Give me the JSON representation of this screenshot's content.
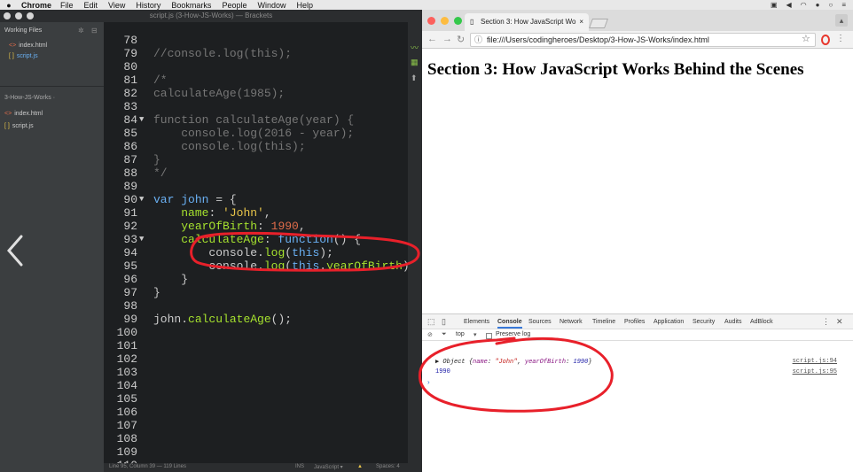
{
  "menubar": {
    "app": "Chrome",
    "items": [
      "File",
      "Edit",
      "View",
      "History",
      "Bookmarks",
      "People",
      "Window",
      "Help"
    ]
  },
  "brackets": {
    "window_title": "script.js (3-How-JS-Works) — Brackets",
    "sidebar": {
      "working_files_label": "Working Files",
      "working_files": [
        {
          "name": "index.html",
          "type": "html"
        },
        {
          "name": "script.js",
          "type": "js",
          "active": true
        }
      ],
      "project_label": "3-How-JS-Works ·",
      "project_files": [
        {
          "name": "index.html",
          "type": "html"
        },
        {
          "name": "script.js",
          "type": "js"
        }
      ]
    },
    "code_lines": [
      {
        "n": 78,
        "fold": "",
        "html": ""
      },
      {
        "n": 79,
        "fold": "",
        "html": "<span class='cm'>//console.log(this);</span>"
      },
      {
        "n": 80,
        "fold": "",
        "html": ""
      },
      {
        "n": 81,
        "fold": "",
        "html": "<span class='cm'>/*</span>"
      },
      {
        "n": 82,
        "fold": "",
        "html": "<span class='cm'>calculateAge(1985);</span>"
      },
      {
        "n": 83,
        "fold": "",
        "html": ""
      },
      {
        "n": 84,
        "fold": "▼",
        "html": "<span class='cm'>function calculateAge(year) {</span>"
      },
      {
        "n": 85,
        "fold": "",
        "html": "<span class='cm'>    console.log(2016 - year);</span>"
      },
      {
        "n": 86,
        "fold": "",
        "html": "<span class='cm'>    console.log(this);</span>"
      },
      {
        "n": 87,
        "fold": "",
        "html": "<span class='cm'>}</span>"
      },
      {
        "n": 88,
        "fold": "",
        "html": "<span class='cm'>*/</span>"
      },
      {
        "n": 89,
        "fold": "",
        "html": ""
      },
      {
        "n": 90,
        "fold": "▼",
        "html": "<span class='kw'>var</span> <span class='kw'>john</span> = {"
      },
      {
        "n": 91,
        "fold": "",
        "html": "    <span class='prop'>name</span>: <span class='str'>'John'</span>,"
      },
      {
        "n": 92,
        "fold": "",
        "html": "    <span class='prop'>yearOfBirth</span>: <span class='num'>1990</span>,"
      },
      {
        "n": 93,
        "fold": "▼",
        "html": "    <span class='prop'>calculateAge</span>: <span class='kw'>function</span>() {"
      },
      {
        "n": 94,
        "fold": "",
        "html": "        <span class='tx'>console</span>.<span class='prop'>log</span>(<span class='kw'>this</span>);"
      },
      {
        "n": 95,
        "fold": "",
        "html": "        <span class='tx'>console</span>.<span class='prop'>log</span>(<span class='kw'>this</span>.<span class='prop'>yearOfBirth</span>);"
      },
      {
        "n": 96,
        "fold": "",
        "html": "    }"
      },
      {
        "n": 97,
        "fold": "",
        "html": "}"
      },
      {
        "n": 98,
        "fold": "",
        "html": ""
      },
      {
        "n": 99,
        "fold": "",
        "html": "<span class='tx'>john</span>.<span class='prop'>calculateAge</span>();"
      },
      {
        "n": 100,
        "fold": "",
        "html": ""
      },
      {
        "n": 101,
        "fold": "",
        "html": ""
      },
      {
        "n": 102,
        "fold": "",
        "html": ""
      },
      {
        "n": 103,
        "fold": "",
        "html": ""
      },
      {
        "n": 104,
        "fold": "",
        "html": ""
      },
      {
        "n": 105,
        "fold": "",
        "html": ""
      },
      {
        "n": 106,
        "fold": "",
        "html": ""
      },
      {
        "n": 107,
        "fold": "",
        "html": ""
      },
      {
        "n": 108,
        "fold": "",
        "html": ""
      },
      {
        "n": 109,
        "fold": "",
        "html": ""
      },
      {
        "n": 110,
        "fold": "",
        "html": ""
      }
    ],
    "status": {
      "cursor": "Line 95, Column 39 — 119 Lines",
      "mode": "INS",
      "language": "JavaScript ▾",
      "spaces": "Spaces: 4"
    }
  },
  "chrome": {
    "tab_title": "Section 3: How JavaScript Wo",
    "url": "file:///Users/codingheroes/Desktop/3-How-JS-Works/index.html",
    "page_heading": "Section 3: How JavaScript Works Behind the Scenes",
    "devtools": {
      "tabs": [
        "Elements",
        "Console",
        "Sources",
        "Network",
        "Timeline",
        "Profiles",
        "Application",
        "Security",
        "Audits",
        "AdBlock"
      ],
      "active_tab": "Console",
      "context": "top",
      "preserve_log_label": "Preserve log",
      "logs": [
        {
          "prefix": "▶ Object {",
          "key1": "name",
          "val1": "\"John\"",
          "key2": "yearOfBirth",
          "val2": "1990",
          "suffix": "}",
          "source": "script.js:94"
        },
        {
          "text": "1990",
          "source": "script.js:95"
        }
      ],
      "prompt": "›"
    }
  },
  "colors": {
    "annotation": "#e8202a",
    "accent": "#3879d9"
  }
}
